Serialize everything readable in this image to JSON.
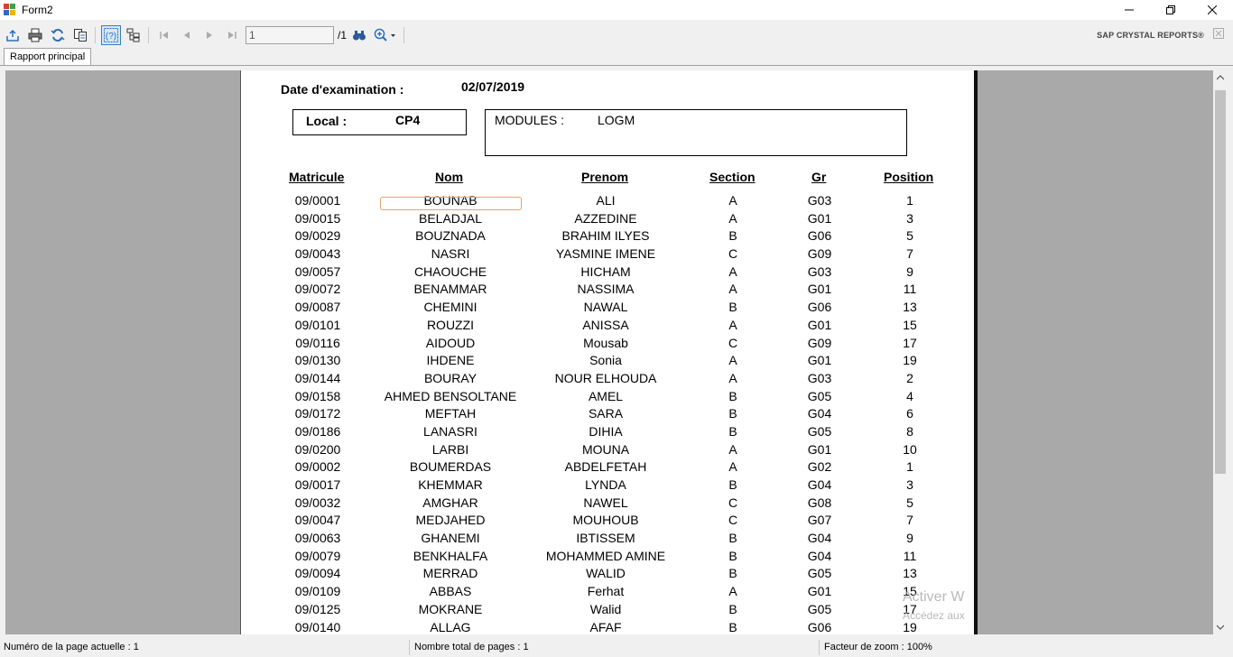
{
  "window": {
    "title": "Form2"
  },
  "toolbar": {
    "page_value": "1",
    "page_total": "/1",
    "brand": "SAP CRYSTAL REPORTS®"
  },
  "tabs": [
    {
      "label": "Rapport principal"
    }
  ],
  "report": {
    "date_label": "Date d'examination :",
    "date_value": "02/07/2019",
    "local_label": "Local :",
    "local_value": "CP4",
    "modules_label": "MODULES :",
    "modules_value": "LOGM",
    "columns": [
      "Matricule",
      "Nom",
      "Prenom",
      "Section",
      "Gr",
      "Position"
    ],
    "rows": [
      [
        "09/0001",
        "BOUNAB",
        "ALI",
        "A",
        "G03",
        "1"
      ],
      [
        "09/0015",
        "BELADJAL",
        "AZZEDINE",
        "A",
        "G01",
        "3"
      ],
      [
        "09/0029",
        "BOUZNADA",
        "BRAHIM ILYES",
        "B",
        "G06",
        "5"
      ],
      [
        "09/0043",
        "NASRI",
        "YASMINE IMENE",
        "C",
        "G09",
        "7"
      ],
      [
        "09/0057",
        "CHAOUCHE",
        "HICHAM",
        "A",
        "G03",
        "9"
      ],
      [
        "09/0072",
        "BENAMMAR",
        "NASSIMA",
        "A",
        "G01",
        "11"
      ],
      [
        "09/0087",
        "CHEMINI",
        "NAWAL",
        "B",
        "G06",
        "13"
      ],
      [
        "09/0101",
        "ROUZZI",
        "ANISSA",
        "A",
        "G01",
        "15"
      ],
      [
        "09/0116",
        "AIDOUD",
        "Mousab",
        "C",
        "G09",
        "17"
      ],
      [
        "09/0130",
        "IHDENE",
        "Sonia",
        "A",
        "G01",
        "19"
      ],
      [
        "09/0144",
        "BOURAY",
        "NOUR ELHOUDA",
        "A",
        "G03",
        "2"
      ],
      [
        "09/0158",
        "AHMED BENSOLTANE",
        "AMEL",
        "B",
        "G05",
        "4"
      ],
      [
        "09/0172",
        "MEFTAH",
        "SARA",
        "B",
        "G04",
        "6"
      ],
      [
        "09/0186",
        "LANASRI",
        "DIHIA",
        "B",
        "G05",
        "8"
      ],
      [
        "09/0200",
        "LARBI",
        "MOUNA",
        "A",
        "G01",
        "10"
      ],
      [
        "09/0002",
        "BOUMERDAS",
        "ABDELFETAH",
        "A",
        "G02",
        "1"
      ],
      [
        "09/0017",
        "KHEMMAR",
        "LYNDA",
        "B",
        "G04",
        "3"
      ],
      [
        "09/0032",
        "AMGHAR",
        "NAWEL",
        "C",
        "G08",
        "5"
      ],
      [
        "09/0047",
        "MEDJAHED",
        "MOUHOUB",
        "C",
        "G07",
        "7"
      ],
      [
        "09/0063",
        "GHANEMI",
        "IBTISSEM",
        "B",
        "G04",
        "9"
      ],
      [
        "09/0079",
        "BENKHALFA",
        "MOHAMMED AMINE",
        "B",
        "G04",
        "11"
      ],
      [
        "09/0094",
        "MERRAD",
        "WALID",
        "B",
        "G05",
        "13"
      ],
      [
        "09/0109",
        "ABBAS",
        "Ferhat",
        "A",
        "G01",
        "15"
      ],
      [
        "09/0125",
        "MOKRANE",
        "Walid",
        "B",
        "G05",
        "17"
      ],
      [
        "09/0140",
        "ALLAG",
        "AFAF",
        "B",
        "G06",
        "19"
      ]
    ]
  },
  "watermark": {
    "line1": "Activer W",
    "line2": "Accédez aux"
  },
  "status": {
    "current_page": "Numéro de la page actuelle : 1",
    "total_pages": "Nombre total de pages : 1",
    "zoom": "Facteur de zoom : 100%"
  },
  "colors": {
    "viewer_bg": "#a9a9a9",
    "highlight": "#e8a070",
    "toolbar_icon": "#2a6ebb"
  }
}
